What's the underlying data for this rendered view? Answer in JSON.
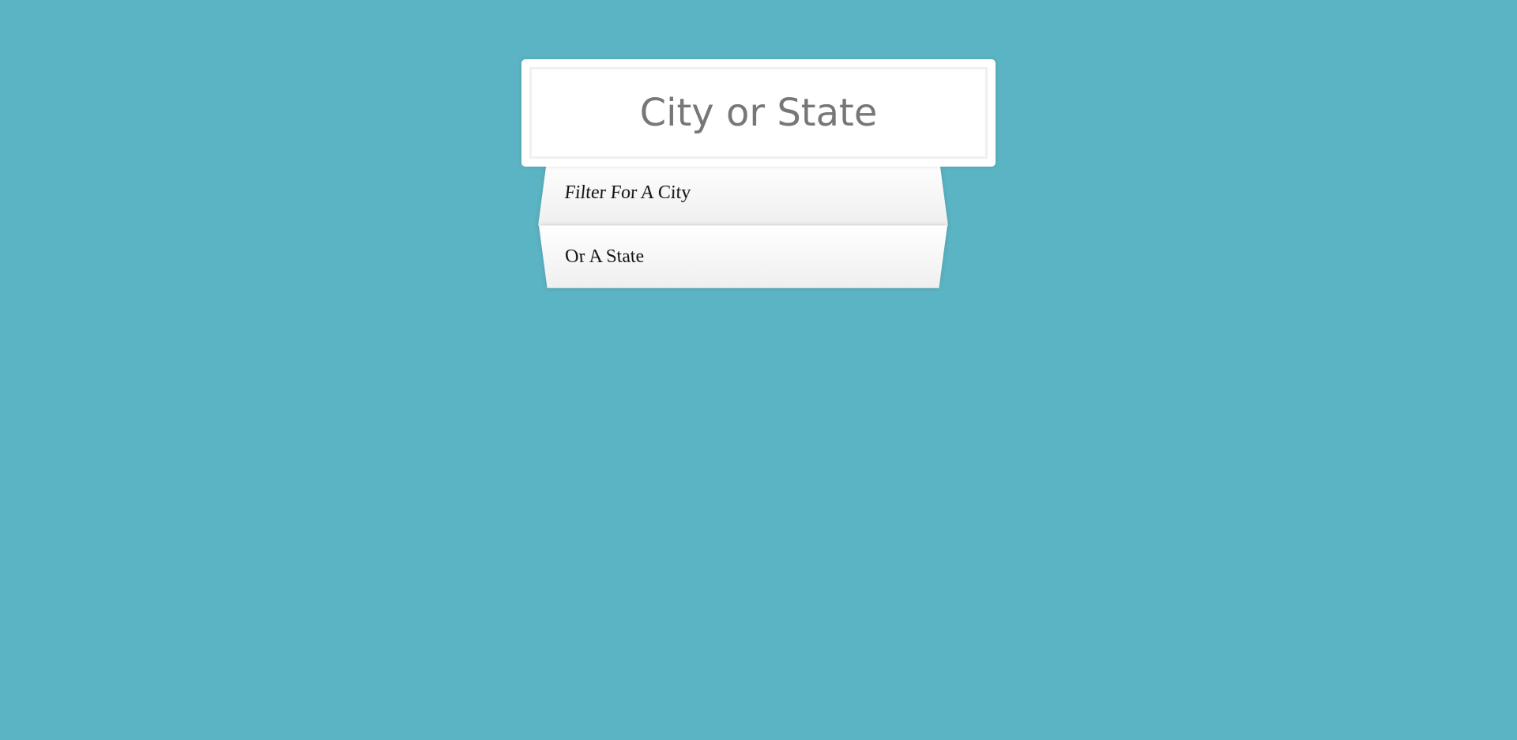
{
  "page": {
    "background_color": "#5bb4c3"
  },
  "search": {
    "value": "",
    "placeholder": "City or State"
  },
  "suggestions": {
    "items": [
      {
        "label": "Filter For A City"
      },
      {
        "label": "Or A State"
      }
    ]
  }
}
